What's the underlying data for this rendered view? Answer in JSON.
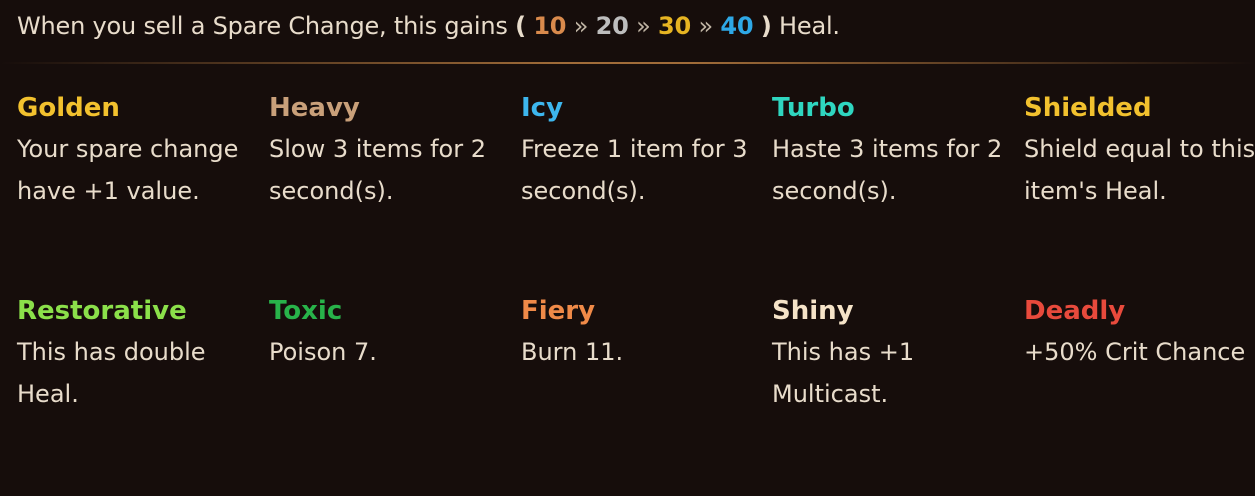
{
  "header": {
    "prefix": "When you sell a Spare Change, this gains",
    "open_paren": "(",
    "tiers": [
      {
        "value": "10",
        "color": "#d98a4c"
      },
      {
        "value": "20",
        "color": "#bdbdbd"
      },
      {
        "value": "30",
        "color": "#e6b422"
      },
      {
        "value": "40",
        "color": "#2ea8e6"
      }
    ],
    "separator": "»",
    "close_paren": ")",
    "suffix": "Heal."
  },
  "enchantments": [
    {
      "name": "Golden",
      "color": "#f2c12e",
      "description": "Your spare change have +1 value."
    },
    {
      "name": "Heavy",
      "color": "#c9a07a",
      "description": "Slow 3 items for 2 second(s)."
    },
    {
      "name": "Icy",
      "color": "#3db6ee",
      "description": "Freeze 1 item for 3 second(s)."
    },
    {
      "name": "Turbo",
      "color": "#2fd6c0",
      "description": "Haste 3 items for 2 second(s)."
    },
    {
      "name": "Shielded",
      "color": "#f2c12e",
      "description": "Shield equal to this item's Heal."
    },
    {
      "name": "Restorative",
      "color": "#8be04a",
      "description": "This has double Heal."
    },
    {
      "name": "Toxic",
      "color": "#28b34a",
      "description": "Poison 7."
    },
    {
      "name": "Fiery",
      "color": "#f08a48",
      "description": "Burn 11."
    },
    {
      "name": "Shiny",
      "color": "#f5e3c8",
      "description": "This has +1 Multicast."
    },
    {
      "name": "Deadly",
      "color": "#e84a3c",
      "description": "+50% Crit Chance"
    }
  ]
}
